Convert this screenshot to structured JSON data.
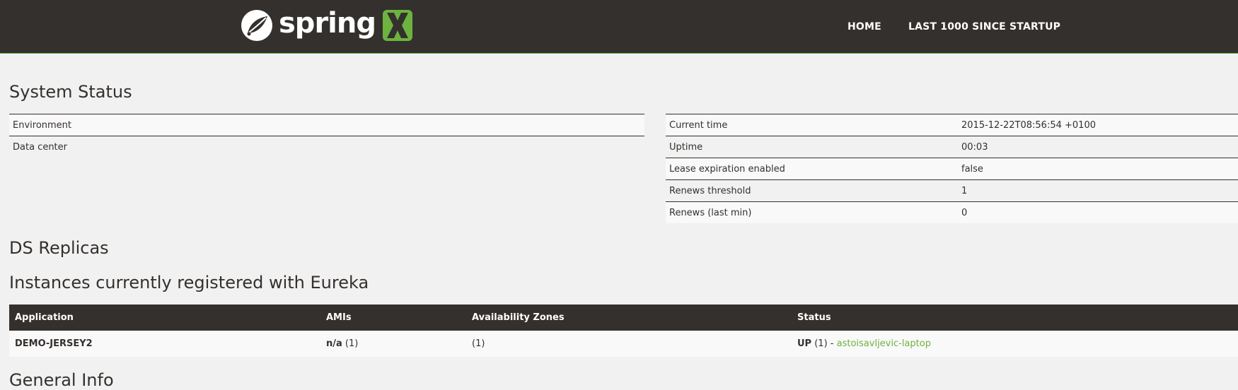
{
  "nav": {
    "brand_text": "spring",
    "home": "HOME",
    "last1000": "LAST 1000 SINCE STARTUP"
  },
  "colors": {
    "header_bg": "#34302d",
    "page_bg": "#f1f1f1",
    "accent_green": "#6db33f",
    "text": "#34302d"
  },
  "icons": {
    "logo_leaf": "spring-leaf-icon",
    "logo_x": "spring-x-icon"
  },
  "system_status": {
    "title": "System Status",
    "environment_rows": [
      {
        "label": "Environment",
        "value": ""
      },
      {
        "label": "Data center",
        "value": ""
      }
    ],
    "info_rows": [
      {
        "label": "Current time",
        "value": "2015-12-22T08:56:54 +0100"
      },
      {
        "label": "Uptime",
        "value": "00:03"
      },
      {
        "label": "Lease expiration enabled",
        "value": "false"
      },
      {
        "label": "Renews threshold",
        "value": "1"
      },
      {
        "label": "Renews (last min)",
        "value": "0"
      }
    ]
  },
  "replicas": {
    "title": "DS Replicas"
  },
  "instances": {
    "title": "Instances currently registered with Eureka",
    "columns": [
      "Application",
      "AMIs",
      "Availability Zones",
      "Status"
    ],
    "rows": [
      {
        "application": "DEMO-JERSEY2",
        "amis_value": "n/a",
        "amis_count": "(1)",
        "zones": "(1)",
        "status": "UP",
        "status_count": "(1)",
        "status_sep": " - ",
        "instance_link": "astoisavljevic-laptop"
      }
    ]
  },
  "general_info": {
    "title": "General Info"
  }
}
